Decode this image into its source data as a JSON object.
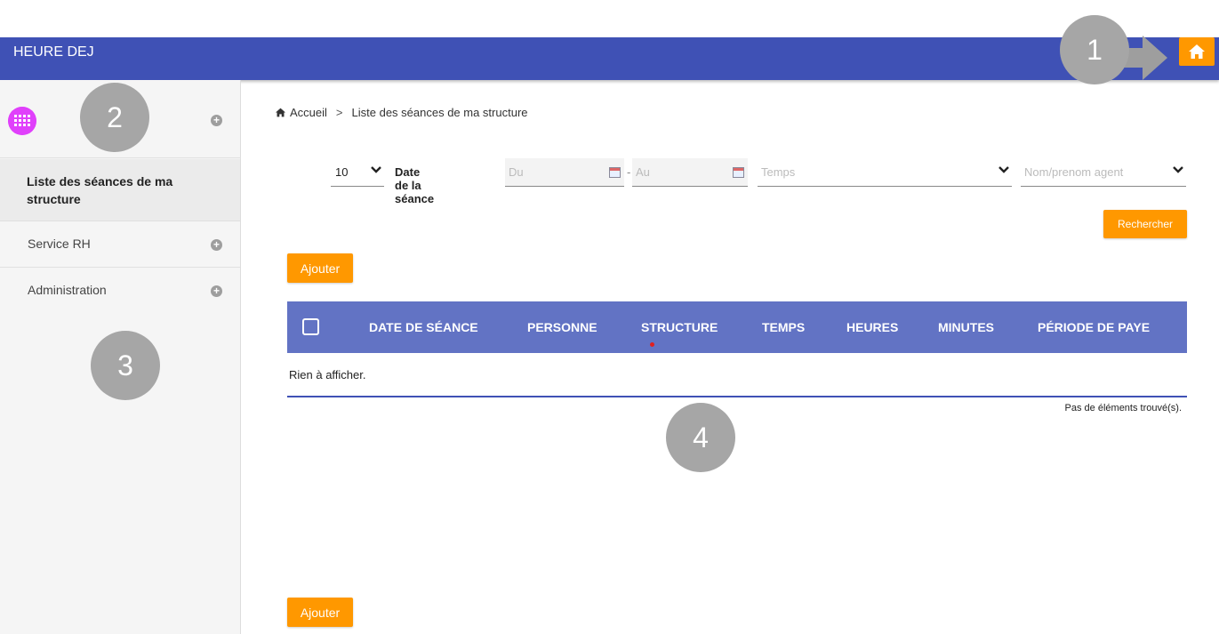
{
  "header": {
    "title": "HEURE DEJ",
    "home_icon": "home-icon",
    "accent": "#3f51b5",
    "button_color": "#ff9800"
  },
  "sidebar": {
    "user_avatar": "avatar",
    "items": [
      {
        "label": "Liste des séances de ma structure",
        "active": true
      },
      {
        "label": "Service RH"
      },
      {
        "label": "Administration"
      }
    ]
  },
  "breadcrumb": {
    "home": "Accueil",
    "separator": ">",
    "current": "Liste des séances de ma structure"
  },
  "filters": {
    "page_size": "10",
    "date_label": "Date de la séance",
    "from_placeholder": "Du",
    "dash": "-",
    "to_placeholder": "Au",
    "temps_placeholder": "Temps",
    "agent_placeholder": "Nom/prenom agent",
    "search_button": "Rechercher"
  },
  "actions": {
    "add_label": "Ajouter"
  },
  "table": {
    "columns": [
      "DATE DE SÉANCE",
      "PERSONNE",
      "STRUCTURE",
      "TEMPS",
      "HEURES",
      "MINUTES",
      "PÉRIODE DE PAYE"
    ],
    "empty_message": "Rien à afficher.",
    "count_message": "Pas de éléments trouvé(s)."
  },
  "callouts": [
    "1",
    "2",
    "3",
    "4"
  ]
}
